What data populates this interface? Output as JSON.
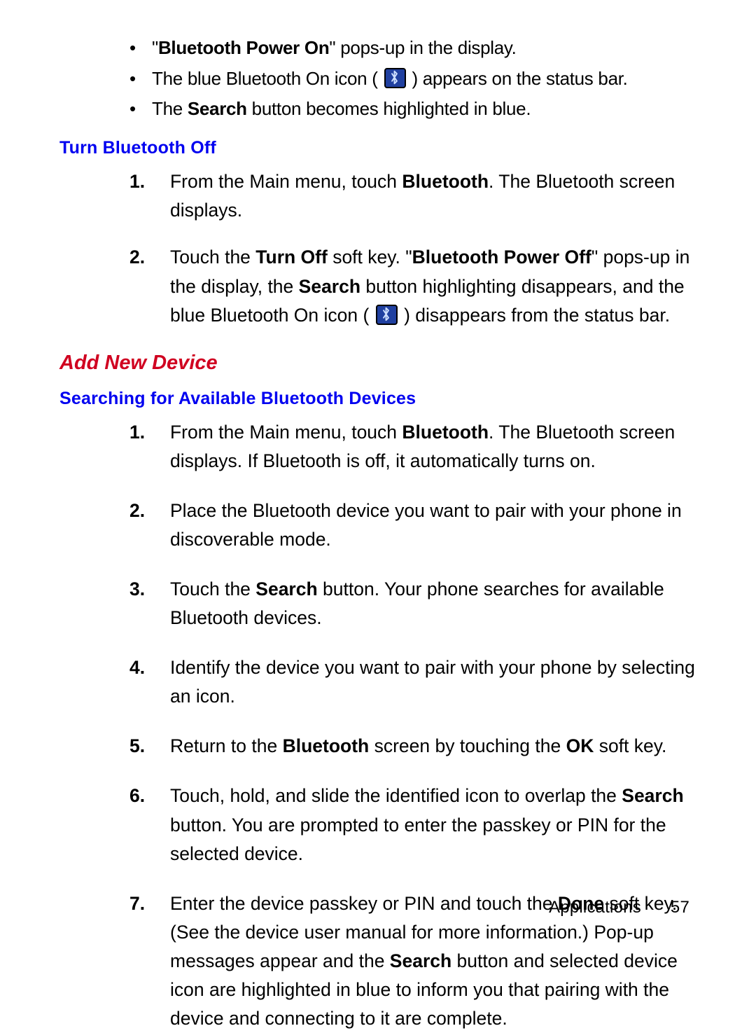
{
  "top_bullets": {
    "b1_pre_quote": "\"",
    "b1_bold": "Bluetooth Power On",
    "b1_post": "\" pops-up in the display.",
    "b2_pre": "The blue Bluetooth On icon (",
    "b2_post": ") appears on the status bar.",
    "b3_pre": "The ",
    "b3_bold": "Search",
    "b3_post": " button becomes highlighted in blue."
  },
  "heading_turn_off": "Turn Bluetooth Off",
  "turn_off_steps": {
    "s1_num": "1.",
    "s1_a": "From the Main menu, touch ",
    "s1_b_bold": "Bluetooth",
    "s1_c": ". The Bluetooth screen displays.",
    "s2_num": "2.",
    "s2_a": "Touch the ",
    "s2_b_bold": "Turn Off",
    "s2_c": " soft key. \"",
    "s2_d_bold": "Bluetooth Power Off",
    "s2_e": "\" pops-up in the display, the ",
    "s2_f_bold": "Search",
    "s2_g": " button highlighting disappears, and the blue Bluetooth On icon (",
    "s2_h": ") disappears from the status bar."
  },
  "heading_add_device": "Add New Device",
  "heading_searching": "Searching for Available Bluetooth Devices",
  "search_steps": {
    "s1_num": "1.",
    "s1_a": "From the Main menu, touch ",
    "s1_b_bold": "Bluetooth",
    "s1_c": ". The Bluetooth screen displays. If Bluetooth is off, it automatically turns on.",
    "s2_num": "2.",
    "s2_a": "Place the Bluetooth device you want to pair with your phone in discoverable mode.",
    "s3_num": "3.",
    "s3_a": "Touch the ",
    "s3_b_bold": "Search",
    "s3_c": " button. Your phone searches for available Bluetooth devices.",
    "s4_num": "4.",
    "s4_a": "Identify the device you want to pair with your phone by selecting an icon.",
    "s5_num": "5.",
    "s5_a": "Return to the ",
    "s5_b_bold": "Bluetooth",
    "s5_c": " screen by touching the ",
    "s5_d_bold": "OK",
    "s5_e": " soft key.",
    "s6_num": "6.",
    "s6_a": "Touch, hold, and slide the identified icon to overlap the ",
    "s6_b_bold": "Search",
    "s6_c": " button. You are prompted to enter the passkey or PIN for the selected device.",
    "s7_num": "7.",
    "s7_a": "Enter the device passkey or PIN and touch the ",
    "s7_b_bold": "Done",
    "s7_c": " soft key. (See the device user manual for more information.) Pop-up messages appear and the ",
    "s7_d_bold": "Search",
    "s7_e": " button and selected device icon are highlighted in blue to inform you that pairing with the device and connecting to it are complete."
  },
  "footer": {
    "section": "Applications",
    "page": "57"
  }
}
